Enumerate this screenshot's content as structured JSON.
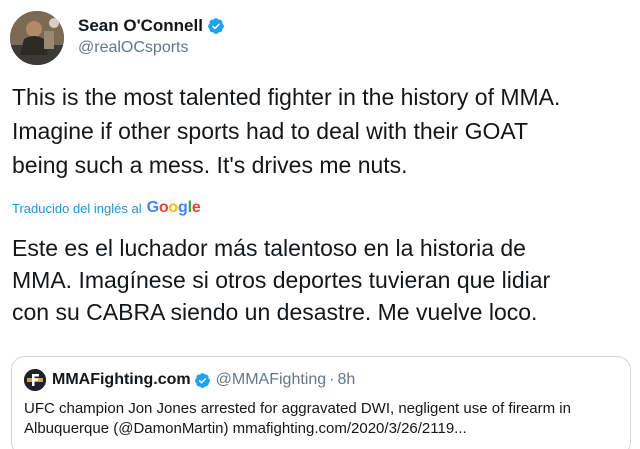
{
  "author": {
    "display_name": "Sean O'Connell",
    "handle": "@realOCsports",
    "verified": true,
    "avatar_icon": "profile-photo"
  },
  "tweet": {
    "text": "This is the most talented fighter in the history of MMA.\nImagine if other sports had to deal with their GOAT\nbeing such a mess.  It's drives me nuts."
  },
  "translation": {
    "label": "Traducido del inglés al",
    "provider": "Google",
    "text": "Este es el luchador más talentoso en la historia de\nMMA. Imagínese si otros deportes tuvieran que lidiar\ncon su CABRA siendo un desastre. Me vuelve loco."
  },
  "quoted_tweet": {
    "display_name": "MMAFighting.com",
    "handle": "@MMAFighting",
    "separator": "·",
    "time": "8h",
    "verified": true,
    "text": "UFC champion Jon Jones arrested for aggravated DWI, negligent use of firearm in\nAlbuquerque (@DamonMartin) mmafighting.com/2020/3/26/2119..."
  },
  "colors": {
    "link_blue": "#1b95e0",
    "verified_blue": "#1da1f2",
    "secondary_text": "#657786",
    "border": "#ccd6dd",
    "google_blue": "#4285f4",
    "google_red": "#ea4335",
    "google_yellow": "#fbbc05",
    "google_green": "#34a853"
  }
}
